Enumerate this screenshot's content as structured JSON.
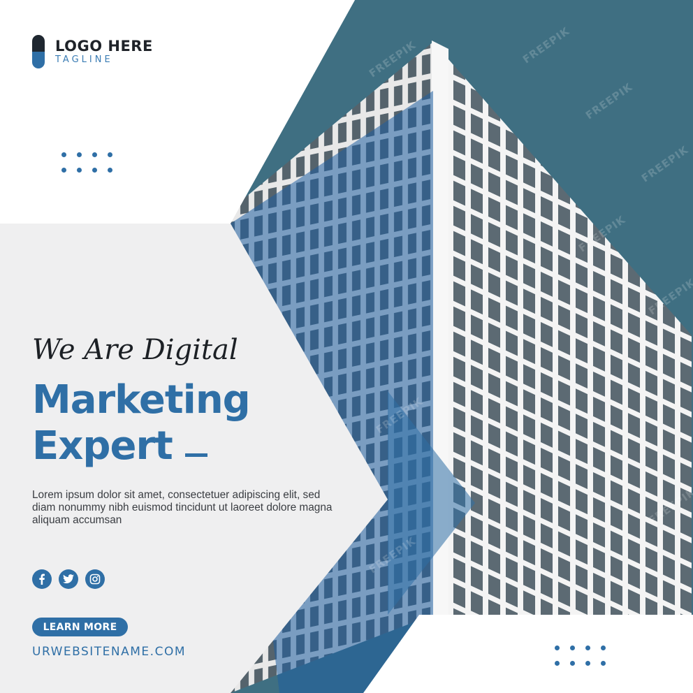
{
  "logo": {
    "title": "LOGO HERE",
    "tagline": "TAGLINE"
  },
  "hero": {
    "script": "We Are Digital",
    "headline_line1": "Marketing",
    "headline_line2": "Expert"
  },
  "body": {
    "paragraph": "Lorem ipsum dolor sit amet, consectetuer adipiscing elit, sed diam nonummy nibh euismod tincidunt ut laoreet dolore magna aliquam accumsan"
  },
  "socials": [
    {
      "icon": "facebook-icon"
    },
    {
      "icon": "twitter-icon"
    },
    {
      "icon": "instagram-icon"
    }
  ],
  "cta": {
    "label": "LEARN MORE"
  },
  "website": {
    "url": "URWEBSITENAME.COM"
  },
  "watermark": {
    "text": "FREEPIK"
  },
  "colors": {
    "accent": "#2f6fa6",
    "dark": "#1f2329",
    "sky": "#3f6f82",
    "panel": "#efeff0"
  }
}
